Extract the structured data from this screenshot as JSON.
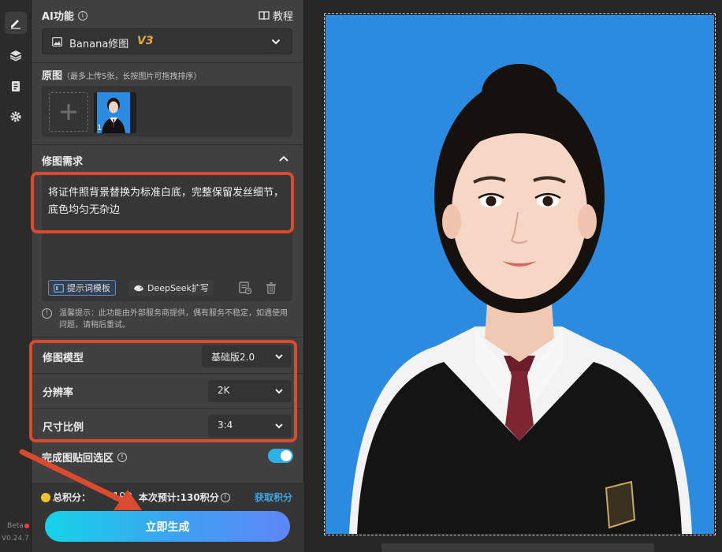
{
  "sidebar": {
    "items": [
      {
        "icon": "pencil-icon",
        "active": true
      },
      {
        "icon": "layers-icon",
        "active": false
      },
      {
        "icon": "clipboard-icon",
        "active": false
      },
      {
        "icon": "gear-icon",
        "active": false
      }
    ],
    "beta_label": "Beta",
    "version": "V0.24.7"
  },
  "ai_function": {
    "title": "AI功能",
    "tutorial_label": "教程",
    "selected_function": "Banana修图",
    "version_badge": "V3"
  },
  "original_images": {
    "title": "原图",
    "hint": "（最多上传5张，长按图片可拖拽排序）",
    "thumbnail_index": "1"
  },
  "edit_request": {
    "title": "修图需求",
    "prompt": "将证件照背景替换为标准白底，完整保留发丝细节，底色均匀无杂边",
    "template_button": "提示词模板",
    "deepseek_button": "DeepSeek扩写",
    "notice": "温馨提示：此功能由外部服务商提供，偶有服务不稳定，如遇使用问题，请稍后重试。"
  },
  "settings": {
    "model_label": "修图模型",
    "model_value": "基础版2.0",
    "resolution_label": "分辨率",
    "resolution_value": "2K",
    "ratio_label": "尺寸比例",
    "ratio_value": "3:4"
  },
  "paste_back": {
    "label": "完成图贴回选区",
    "enabled": true
  },
  "footer": {
    "total_credits_label": "总积分：",
    "total_credits_value": "199",
    "estimate_label": "本次预计:130积分",
    "get_credits": "获取积分",
    "generate_button": "立即生成"
  },
  "colors": {
    "accent_blue": "#2bb1e6",
    "highlight_red": "#d94a2f",
    "photo_background": "#2a8be1",
    "v3_badge": "#e9a93a"
  }
}
